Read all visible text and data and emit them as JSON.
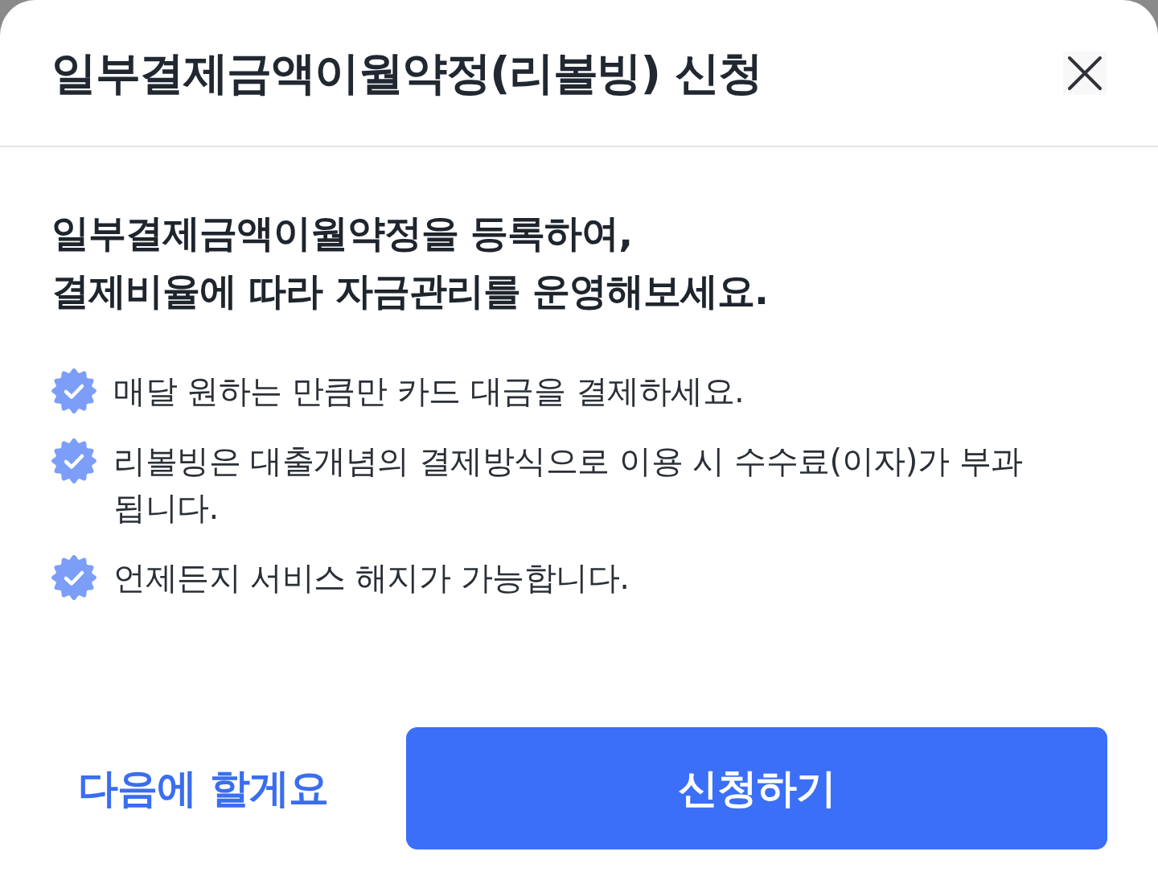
{
  "sheet": {
    "title": "일부결제금액이월약정(리볼빙) 신청"
  },
  "heading": {
    "lines": [
      "일부결제금액이월약정을 등록하여,",
      "결제비율에 따라 자금관리를 운영해보세요."
    ]
  },
  "benefits": [
    {
      "text": "매달 원하는 만큼만 카드 대금을 결제하세요."
    },
    {
      "text": "리볼빙은 대출개념의 결제방식으로 이용 시 수수료(이자)가 부과 됩니다."
    },
    {
      "text": "언제든지 서비스 해지가 가능합니다."
    }
  ],
  "buttons": [
    {
      "label": "다음에 할게요",
      "kind": "text"
    },
    {
      "label": "신청하기",
      "kind": "primary"
    }
  ]
}
